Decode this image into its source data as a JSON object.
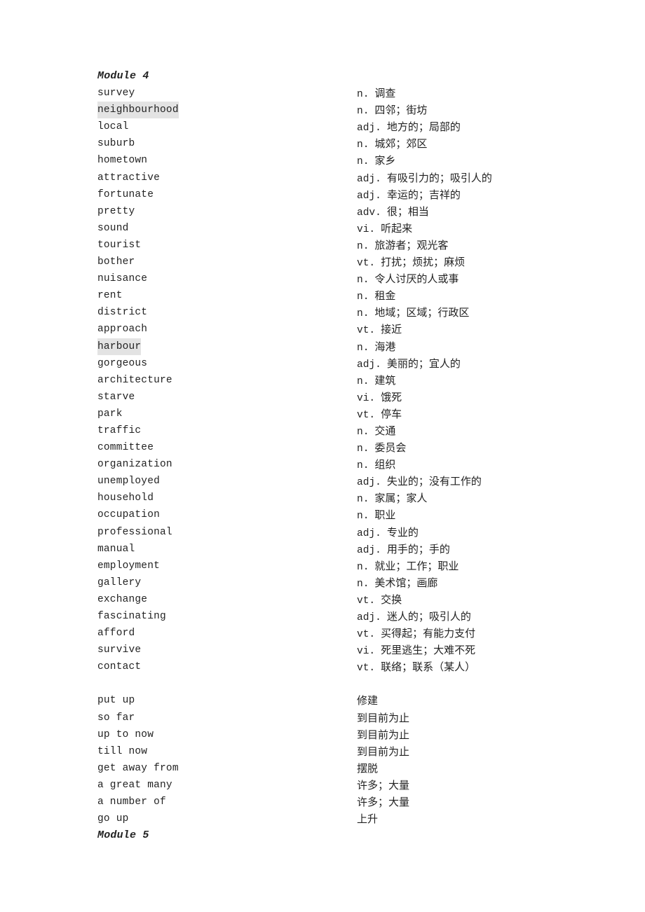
{
  "sections": [
    {
      "title": "Module 4",
      "words": [
        {
          "en": "survey",
          "pos": "n.",
          "zh": "调查"
        },
        {
          "en": "neighbourhood",
          "pos": "n.",
          "zh": "四邻；街坊",
          "highlight": true
        },
        {
          "en": "local",
          "pos": "adj.",
          "zh": "地方的；局部的"
        },
        {
          "en": "suburb",
          "pos": "n.",
          "zh": "城郊；郊区"
        },
        {
          "en": "hometown",
          "pos": "n.",
          "zh": "家乡"
        },
        {
          "en": "attractive",
          "pos": "adj.",
          "zh": "有吸引力的；吸引人的"
        },
        {
          "en": "fortunate",
          "pos": "adj.",
          "zh": "幸运的；吉祥的"
        },
        {
          "en": "pretty",
          "pos": "adv.",
          "zh": "很；相当"
        },
        {
          "en": "sound",
          "pos": "vi.",
          "zh": "听起来"
        },
        {
          "en": "tourist",
          "pos": "n.",
          "zh": "旅游者；观光客"
        },
        {
          "en": "bother",
          "pos": "vt.",
          "zh": "打扰；烦扰；麻烦"
        },
        {
          "en": "nuisance",
          "pos": "n.",
          "zh": "令人讨厌的人或事"
        },
        {
          "en": "rent",
          "pos": "n.",
          "zh": "租金"
        },
        {
          "en": "district",
          "pos": "n.",
          "zh": "地域；区域；行政区"
        },
        {
          "en": "approach",
          "pos": "vt.",
          "zh": "接近"
        },
        {
          "en": "harbour",
          "pos": "n.",
          "zh": "海港",
          "highlight": true
        },
        {
          "en": "gorgeous",
          "pos": "adj.",
          "zh": "美丽的；宜人的"
        },
        {
          "en": "architecture",
          "pos": "n.",
          "zh": "建筑"
        },
        {
          "en": "starve",
          "pos": "vi.",
          "zh": "饿死"
        },
        {
          "en": "park",
          "pos": "vt.",
          "zh": "停车"
        },
        {
          "en": "traffic",
          "pos": "n.",
          "zh": "交通"
        },
        {
          "en": "committee",
          "pos": "n.",
          "zh": "委员会"
        },
        {
          "en": "organization",
          "pos": "n.",
          "zh": "组织"
        },
        {
          "en": "unemployed",
          "pos": "adj.",
          "zh": "失业的；没有工作的"
        },
        {
          "en": "household",
          "pos": "n.",
          "zh": "家属；家人"
        },
        {
          "en": "occupation",
          "pos": "n.",
          "zh": "职业"
        },
        {
          "en": "professional",
          "pos": "adj.",
          "zh": "专业的"
        },
        {
          "en": "manual",
          "pos": "adj.",
          "zh": "用手的；手的"
        },
        {
          "en": "employment",
          "pos": "n.",
          "zh": "就业；工作；职业"
        },
        {
          "en": "gallery",
          "pos": "n.",
          "zh": "美术馆；画廊"
        },
        {
          "en": "exchange",
          "pos": "vt.",
          "zh": "交换"
        },
        {
          "en": "fascinating",
          "pos": "adj.",
          "zh": "迷人的；吸引人的"
        },
        {
          "en": "afford",
          "pos": "vt.",
          "zh": "买得起；有能力支付"
        },
        {
          "en": "survive",
          "pos": "vi.",
          "zh": "死里逃生；大难不死"
        },
        {
          "en": "contact",
          "pos": "vt.",
          "zh": "联络；联系（某人）"
        }
      ],
      "phrases": [
        {
          "en": "put up",
          "zh": "修建"
        },
        {
          "en": "so far",
          "zh": "到目前为止"
        },
        {
          "en": "up to now",
          "zh": "到目前为止"
        },
        {
          "en": "till now",
          "zh": "到目前为止"
        },
        {
          "en": "get away from",
          "zh": "摆脱"
        },
        {
          "en": "a great many",
          "zh": "许多；大量"
        },
        {
          "en": "a number of",
          "zh": "许多；大量"
        },
        {
          "en": "go up",
          "zh": "上升"
        }
      ]
    },
    {
      "title": "Module 5",
      "words": [],
      "phrases": []
    }
  ],
  "colors": {
    "text": "#222222",
    "highlight": "#e3e3e3",
    "background": "#ffffff"
  }
}
